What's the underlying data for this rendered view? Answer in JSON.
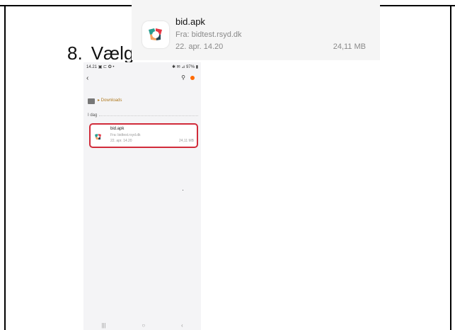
{
  "step": {
    "number": "8.",
    "text": "Vælg"
  },
  "notification": {
    "file_name": "bid.apk",
    "source": "Fra: bidtest.rsyd.dk",
    "date": "22. apr. 14.20",
    "size": "24,11 MB"
  },
  "phone": {
    "status_time": "14.21",
    "status_icons": "▣ ⊏ ✪ •",
    "status_right": "✱ ✉ ⊿ 97% ▮",
    "breadcrumb": "▸ Downloads",
    "section_label": "I dag",
    "item": {
      "name": "bid.apk",
      "source": "Fra: bidtest.rsyd.dk",
      "date": "22. apr. 14.20",
      "size": "24,11 MB"
    },
    "nav": {
      "recent": "|||",
      "home": "○",
      "back": "‹"
    }
  }
}
